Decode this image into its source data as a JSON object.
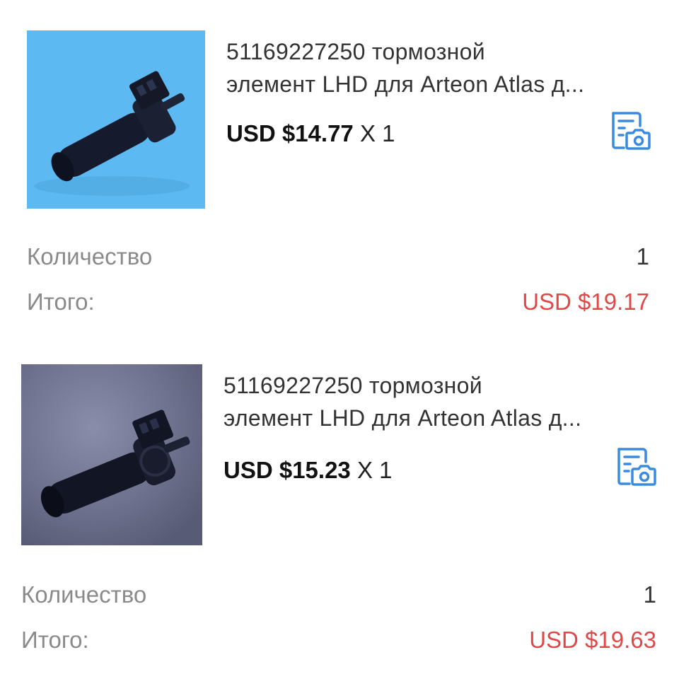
{
  "colors": {
    "total_red": "#e04848",
    "icon_blue": "#3a8be0",
    "label_gray": "#8a8a8a"
  },
  "orders": [
    {
      "title_line1": "51169227250 тормозной",
      "title_line2": "элемент LHD для Arteon Atlas д...",
      "price": "USD $14.77",
      "quantity_multiplier": "X 1",
      "quantity_label": "Количество",
      "quantity_value": "1",
      "total_label": "Итого:",
      "total_value": "USD $19.17",
      "snapshot_icon": "document-camera-icon"
    },
    {
      "title_line1": "51169227250 тормозной",
      "title_line2": "элемент LHD для Arteon Atlas д...",
      "price": "USD $15.23",
      "quantity_multiplier": "X 1",
      "quantity_label": "Количество",
      "quantity_value": "1",
      "total_label": "Итого:",
      "total_value": "USD $19.63",
      "snapshot_icon": "document-camera-icon"
    }
  ]
}
